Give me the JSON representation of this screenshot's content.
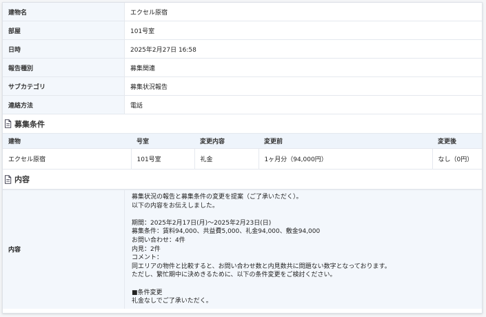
{
  "info": {
    "rows": [
      {
        "label": "建物名",
        "value": "エクセル原宿"
      },
      {
        "label": "部屋",
        "value": "101号室"
      },
      {
        "label": "日時",
        "value": "2025年2月27日 16:58"
      },
      {
        "label": "報告種別",
        "value": "募集関連"
      },
      {
        "label": "サブカテゴリ",
        "value": "募集状況報告"
      },
      {
        "label": "連絡方法",
        "value": "電話"
      }
    ]
  },
  "recruit": {
    "title": "募集条件",
    "headers": [
      "建物",
      "号室",
      "変更内容",
      "変更前",
      "変更後"
    ],
    "row": [
      "エクセル原宿",
      "101号室",
      "礼金",
      "1ヶ月分（94,000円）",
      "なし（0円）"
    ]
  },
  "content": {
    "title": "内容",
    "label": "内容",
    "text": "募集状況の報告と募集条件の変更を提案（ご了承いただく）。\n以下の内容をお伝えしました。\n\n期間：2025年2月17日(月)〜2025年2月23日(日)\n募集条件：賃料94,000、共益費5,000、礼金94,000、敷金94,000\nお問い合わせ：4件\n内見：2件\nコメント：\n同エリアの物件と比較すると、お問い合わせ数と内見数共に問題ない数字となっております。\nただし、繁忙期中に決めきるために、以下の条件変更をご検討ください。\n\n■条件変更\n礼金なしでご了承いただく。"
  },
  "icons": {
    "section": "document-icon"
  }
}
